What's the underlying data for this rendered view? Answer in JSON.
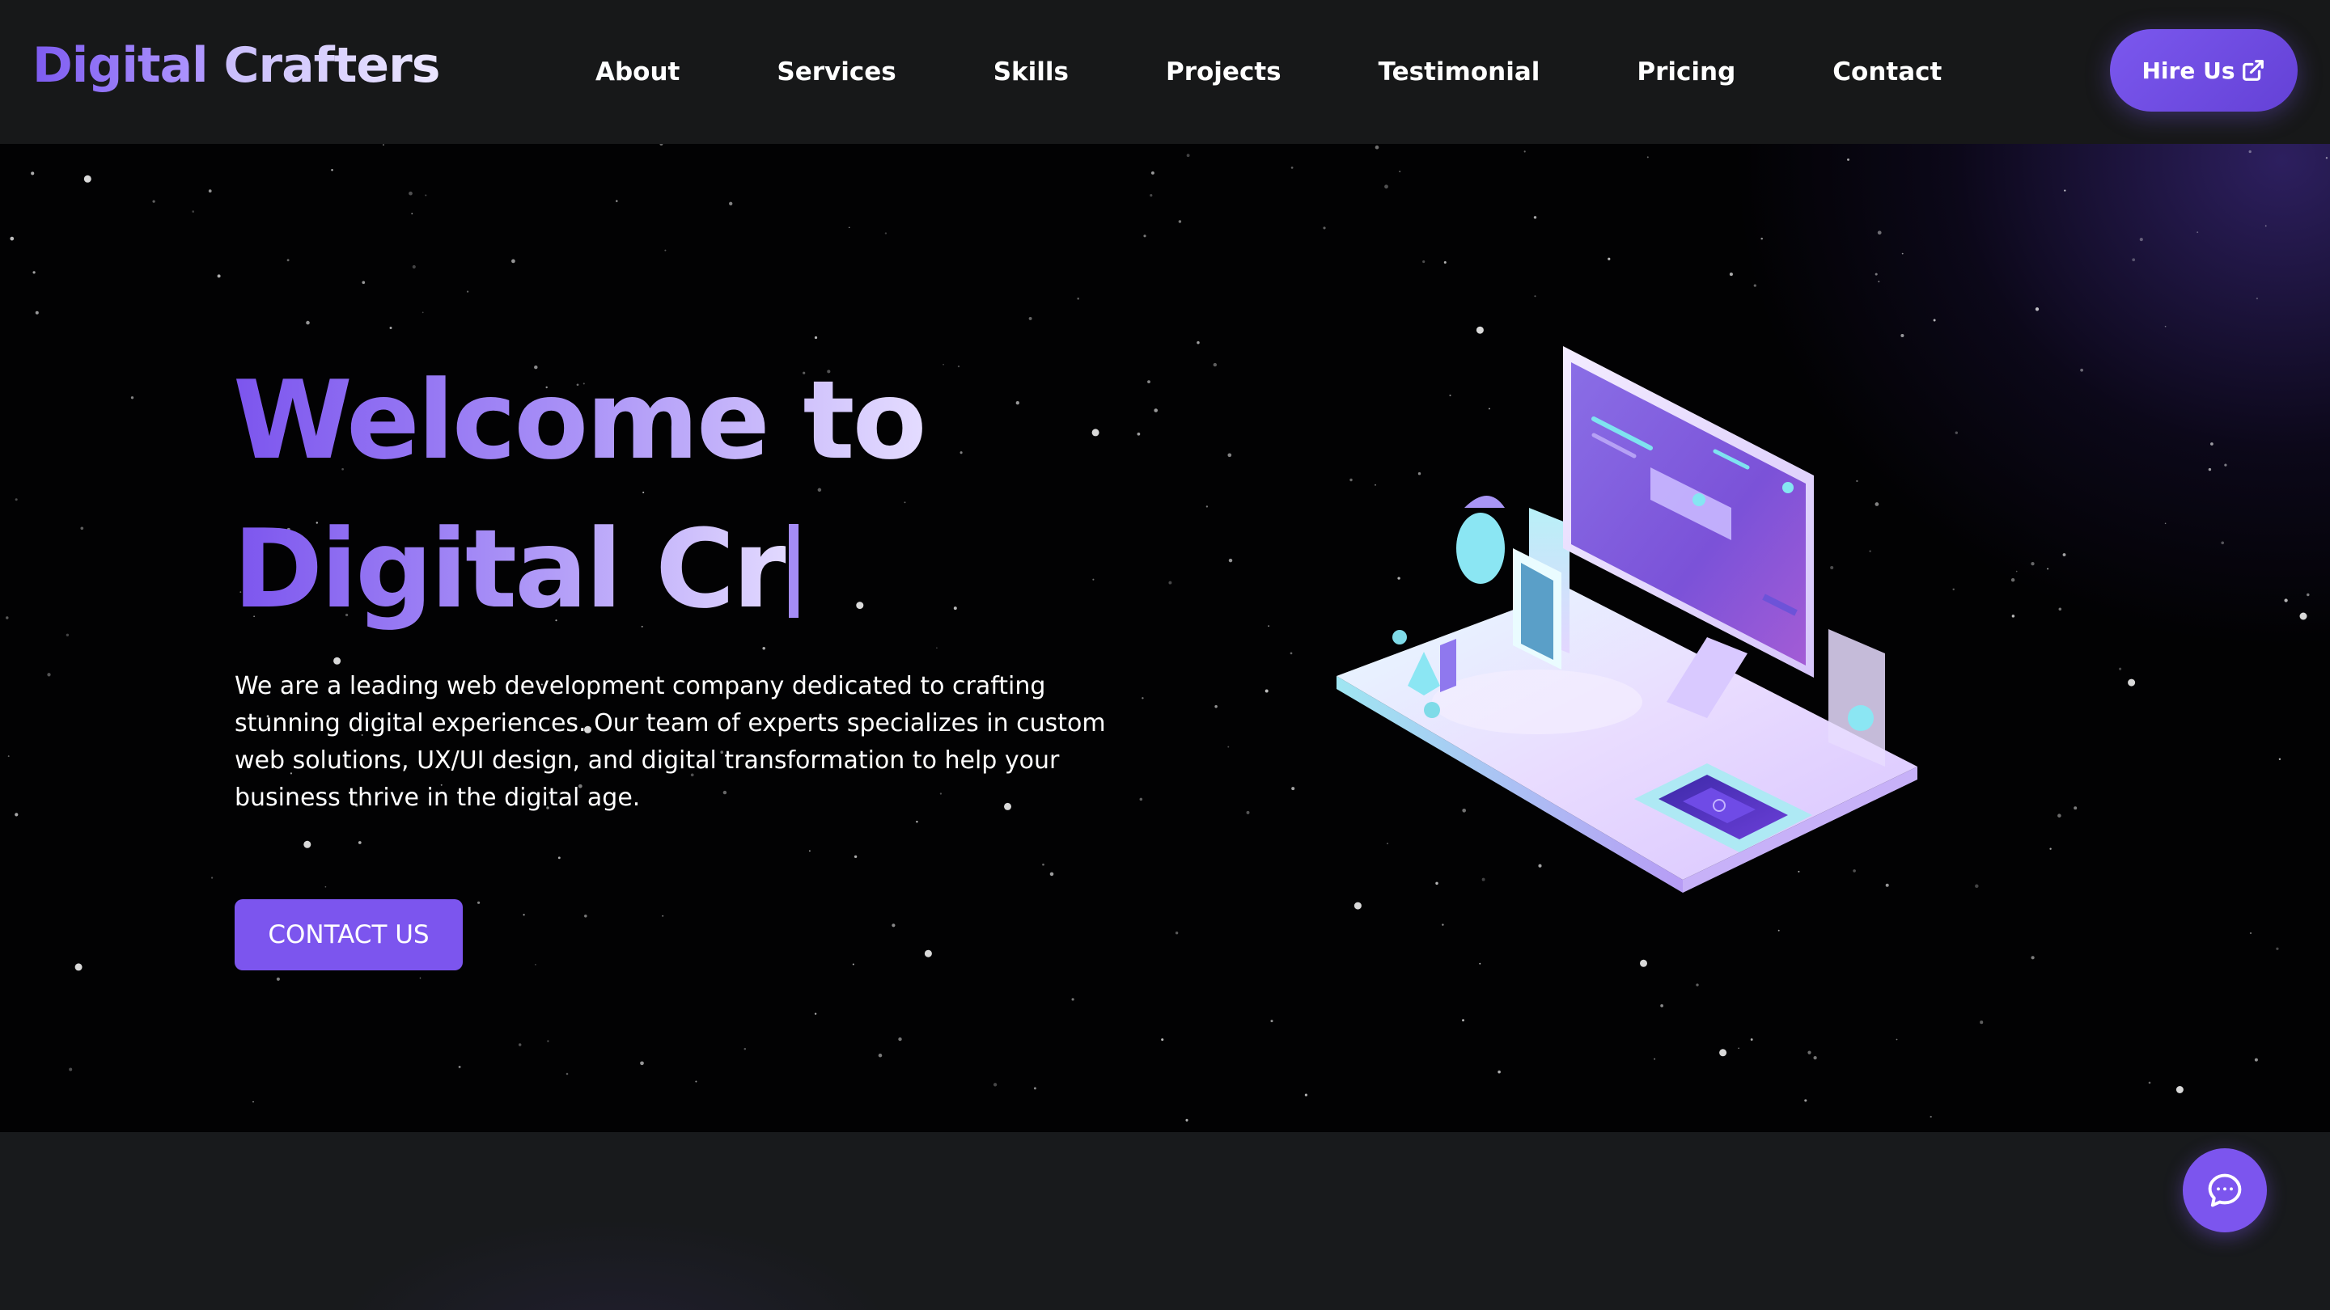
{
  "brand": {
    "part1": "Digital",
    "part2": "Crafters"
  },
  "nav": {
    "links": [
      "About",
      "Services",
      "Skills",
      "Projects",
      "Testimonial",
      "Pricing",
      "Contact"
    ],
    "hire_label": "Hire Us",
    "hire_icon": "external-link-icon"
  },
  "hero": {
    "title_line1": "Welcome to",
    "title_line2": "Digital Cr",
    "description": "We are a leading web development company dedicated to crafting stunning digital experiences. Our team of experts specializes in custom web solutions, UX/UI design, and digital transformation to help your business thrive in the digital age.",
    "cta_label": "CONTACT US",
    "illustration_icon": "isometric-computer-illustration"
  },
  "chat": {
    "icon": "chat-bubble-icon"
  },
  "colors": {
    "accent": "#7c55ee",
    "navbar_bg": "#171819",
    "hero_bg": "#020203",
    "lower_bg": "#181a1c"
  }
}
